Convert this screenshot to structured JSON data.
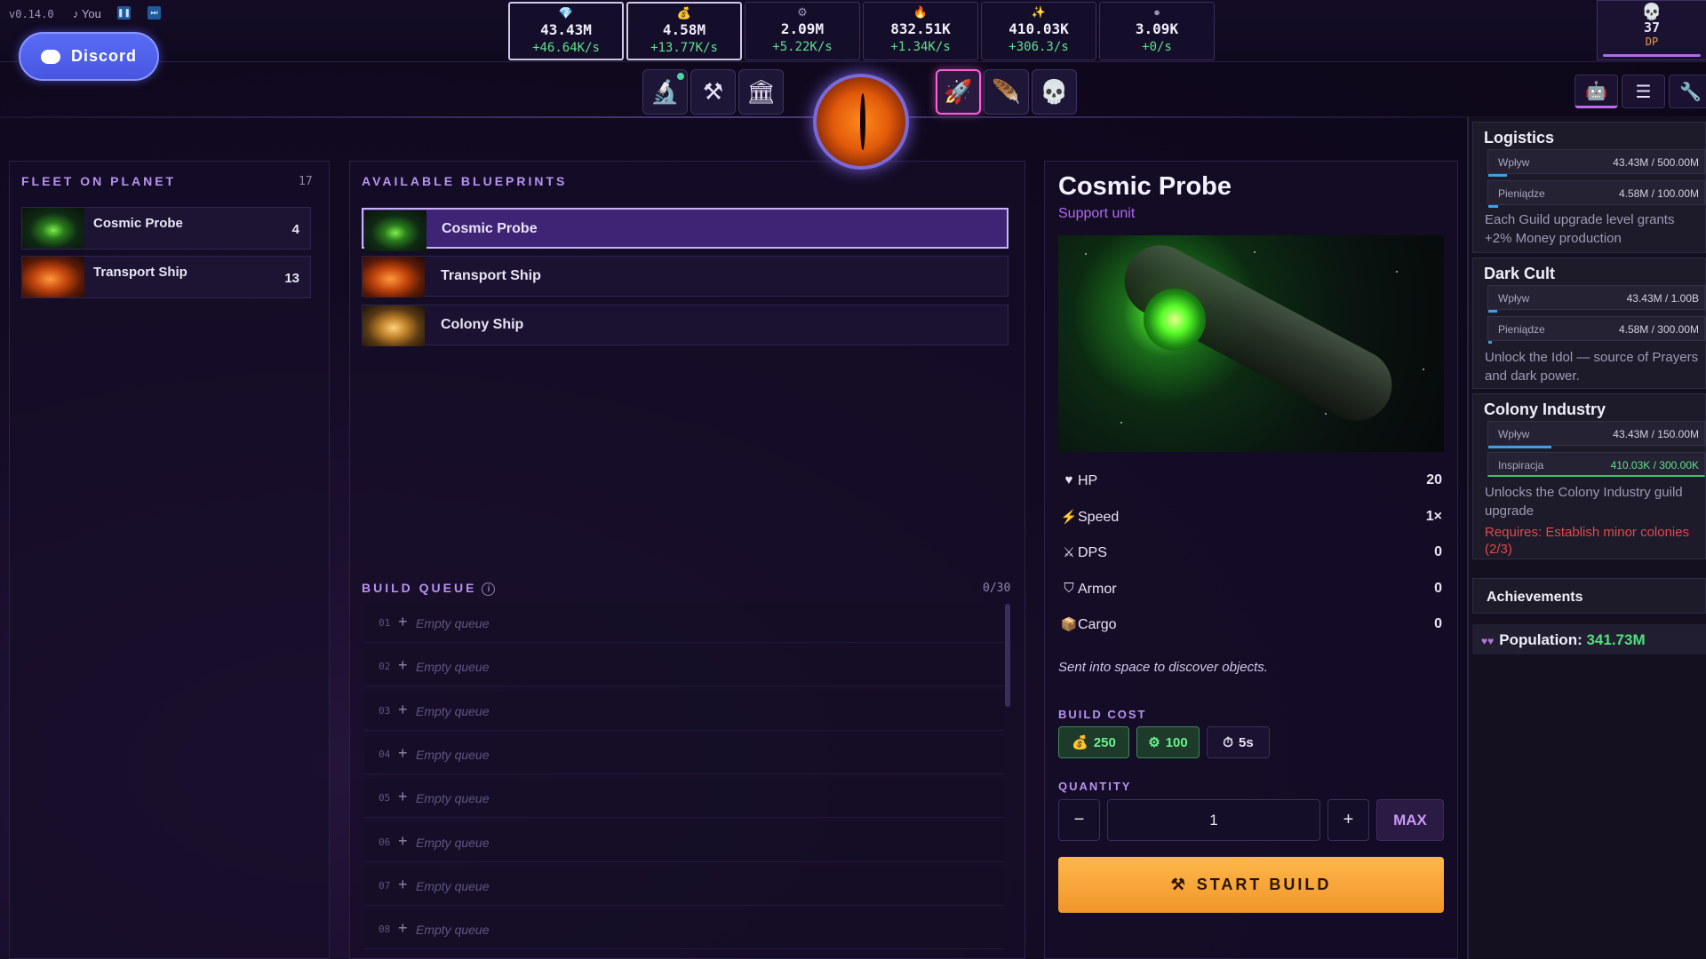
{
  "topbar": {
    "version": "v0.14.0",
    "music": "♪ You",
    "discord_label": "Discord",
    "resources": [
      {
        "icon": "gem-icon",
        "glyph": "💎",
        "value": "43.43M",
        "rate": "+46.64K/s",
        "active": true
      },
      {
        "icon": "money-bag-icon",
        "glyph": "💰",
        "value": "4.58M",
        "rate": "+13.77K/s",
        "active": true
      },
      {
        "icon": "gear-icon",
        "glyph": "⚙",
        "value": "2.09M",
        "rate": "+5.22K/s",
        "active": false
      },
      {
        "icon": "flame-icon",
        "glyph": "🔥",
        "value": "832.51K",
        "rate": "+1.34K/s",
        "active": false
      },
      {
        "icon": "sparkle-icon",
        "glyph": "✨",
        "value": "410.03K",
        "rate": "+306.3/s",
        "active": false
      },
      {
        "icon": "orb-icon",
        "glyph": "●",
        "value": "3.09K",
        "rate": "+0/s",
        "active": false
      }
    ],
    "dp": {
      "value": "37",
      "label": "DP"
    }
  },
  "fleet": {
    "title": "FLEET ON PLANET",
    "count": "17",
    "items": [
      {
        "name": "Cosmic Probe",
        "count": "4"
      },
      {
        "name": "Transport Ship",
        "count": "13"
      }
    ]
  },
  "blueprints": {
    "title": "AVAILABLE BLUEPRINTS",
    "items": [
      {
        "name": "Cosmic Probe",
        "selected": true
      },
      {
        "name": "Transport Ship",
        "selected": false
      },
      {
        "name": "Colony Ship",
        "selected": false
      }
    ]
  },
  "queue": {
    "title": "BUILD QUEUE",
    "count": "0/30",
    "rows": [
      {
        "num": "01",
        "text": "Empty queue"
      },
      {
        "num": "02",
        "text": "Empty queue"
      },
      {
        "num": "03",
        "text": "Empty queue"
      },
      {
        "num": "04",
        "text": "Empty queue"
      },
      {
        "num": "05",
        "text": "Empty queue"
      },
      {
        "num": "06",
        "text": "Empty queue"
      },
      {
        "num": "07",
        "text": "Empty queue"
      },
      {
        "num": "08",
        "text": "Empty queue"
      }
    ]
  },
  "detail": {
    "title": "Cosmic Probe",
    "subtitle": "Support unit",
    "stats": [
      {
        "icon": "heart-icon",
        "glyph": "♥",
        "label": "HP",
        "value": "20"
      },
      {
        "icon": "lightning-icon",
        "glyph": "⚡",
        "label": "Speed",
        "value": "1×"
      },
      {
        "icon": "swords-icon",
        "glyph": "⚔",
        "label": "DPS",
        "value": "0"
      },
      {
        "icon": "shield-icon",
        "glyph": "⛉",
        "label": "Armor",
        "value": "0"
      },
      {
        "icon": "box-icon",
        "glyph": "📦",
        "label": "Cargo",
        "value": "0"
      }
    ],
    "description": "Sent into space to discover objects.",
    "build_cost_label": "BUILD COST",
    "costs": [
      {
        "icon": "money-bag-icon",
        "glyph": "💰",
        "value": "250"
      },
      {
        "icon": "gear-icon",
        "glyph": "⚙",
        "value": "100"
      },
      {
        "icon": "timer-icon",
        "glyph": "⏱",
        "value": "5s"
      }
    ],
    "quantity_label": "QUANTITY",
    "quantity": "1",
    "minus": "−",
    "plus": "+",
    "max": "MAX",
    "start": "START BUILD"
  },
  "sidebar": {
    "logistics": {
      "title": "Logistics",
      "rows": [
        {
          "label": "Wpływ",
          "value": "43.43M / 500.00M",
          "progress": 0.087
        },
        {
          "label": "Pieniądze",
          "value": "4.58M / 100.00M",
          "progress": 0.046
        }
      ],
      "desc": "Each Guild upgrade level grants +2% Money production"
    },
    "dark_cult": {
      "title": "Dark Cult",
      "rows": [
        {
          "label": "Wpływ",
          "value": "43.43M / 1.00B",
          "progress": 0.043
        },
        {
          "label": "Pieniądze",
          "value": "4.58M / 300.00M",
          "progress": 0.015
        }
      ],
      "desc": "Unlock the Idol — source of Prayers and dark power."
    },
    "colony_industry": {
      "title": "Colony Industry",
      "rows": [
        {
          "label": "Wpływ",
          "value": "43.43M / 150.00M",
          "progress": 0.29
        },
        {
          "label": "Inspiracja",
          "value": "410.03K / 300.00K",
          "progress": 1.0
        }
      ],
      "desc": "Unlocks the Colony Industry guild upgrade",
      "requirement": "Requires: Establish minor colonies (2/3)"
    },
    "achievements": "Achievements",
    "population_label": "Population:",
    "population_value": "341.73M"
  }
}
